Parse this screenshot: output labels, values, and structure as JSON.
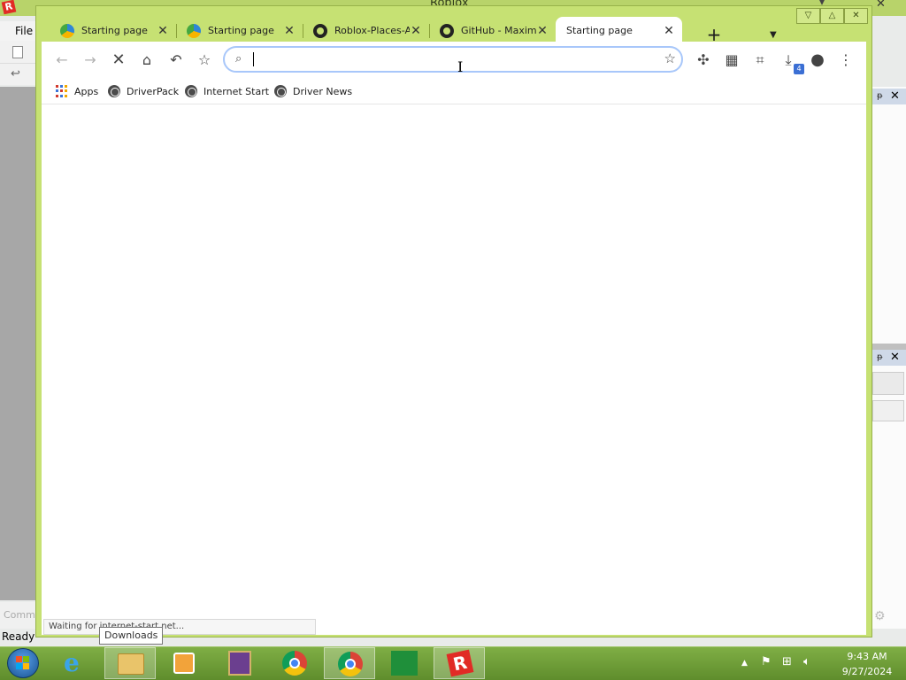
{
  "background_app": {
    "title": "Roblox",
    "menu_file": "File",
    "status": "Ready",
    "command_hint": "Comm",
    "logo_letter": "R"
  },
  "browser": {
    "tabs": [
      {
        "label": "Starting page",
        "icon": "spinner-icon",
        "active": false
      },
      {
        "label": "Starting page",
        "icon": "spinner-icon",
        "active": false
      },
      {
        "label": "Roblox-Places-A",
        "icon": "github-icon",
        "active": false
      },
      {
        "label": "GitHub - Maxim",
        "icon": "github-icon",
        "active": false
      },
      {
        "label": "Starting page",
        "icon": "none",
        "active": true
      }
    ],
    "new_tab_label": "+",
    "tab_close_glyph": "✕",
    "omnibox": {
      "value": "",
      "placeholder": ""
    },
    "bookmarks": [
      {
        "label": "Apps",
        "icon": "apps-icon"
      },
      {
        "label": "DriverPack",
        "icon": "globe-icon"
      },
      {
        "label": "Internet Start",
        "icon": "globe-icon"
      },
      {
        "label": "Driver News",
        "icon": "globe-icon"
      }
    ],
    "downloads_badge": "4",
    "status_text": "Waiting for internet-start.net..."
  },
  "tooltip": "Downloads",
  "taskbar": {
    "time": "9:43 AM",
    "date": "9/27/2024"
  },
  "colors": {
    "chrome_frame": "#c6e173",
    "taskbar": "#6f9c3c",
    "omnibox_focus": "#a8c7fa",
    "roblox_red": "#e12b25"
  }
}
